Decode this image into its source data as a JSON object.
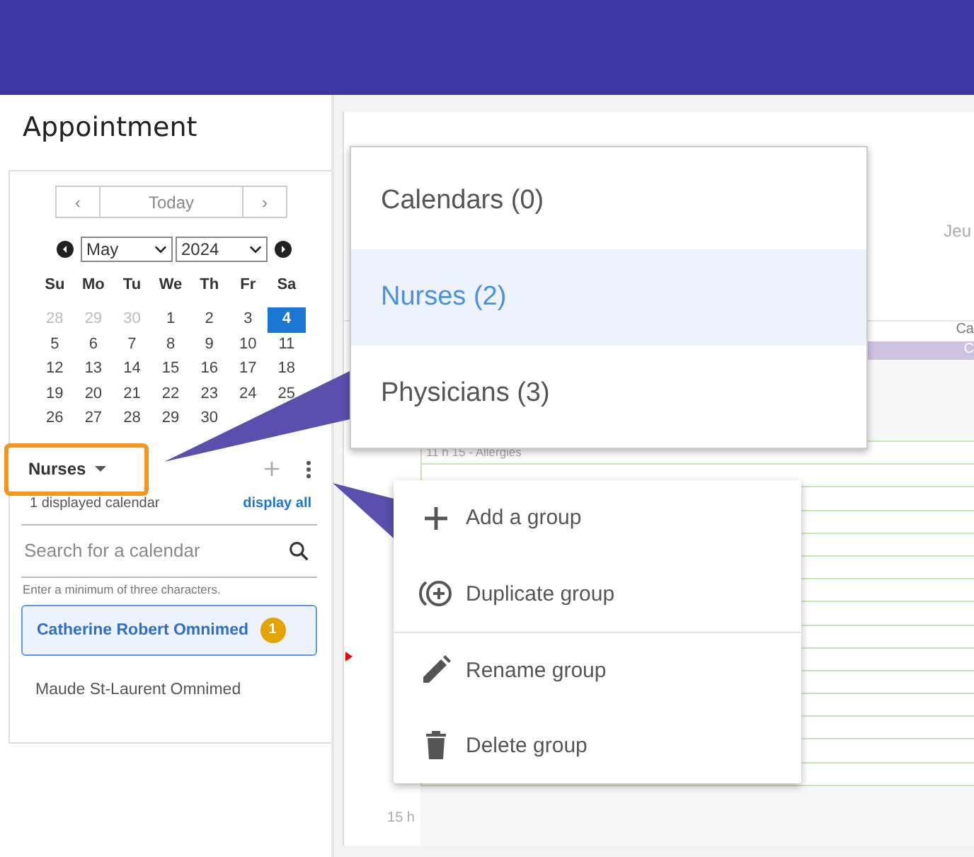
{
  "page_title": "Appointment",
  "mini_calendar": {
    "prev": "‹",
    "today": "Today",
    "next": "›",
    "month": "May",
    "year": "2024",
    "weekdays": [
      "Su",
      "Mo",
      "Tu",
      "We",
      "Th",
      "Fr",
      "Sa"
    ],
    "weeks": [
      [
        {
          "day": "28",
          "muted": true,
          "selected": false
        },
        {
          "day": "29",
          "muted": true,
          "selected": false
        },
        {
          "day": "30",
          "muted": true,
          "selected": false
        },
        {
          "day": "1",
          "muted": false,
          "selected": false
        },
        {
          "day": "2",
          "muted": false,
          "selected": false
        },
        {
          "day": "3",
          "muted": false,
          "selected": false
        },
        {
          "day": "4",
          "muted": false,
          "selected": true
        }
      ],
      [
        {
          "day": "5",
          "muted": false,
          "selected": false
        },
        {
          "day": "6",
          "muted": false,
          "selected": false
        },
        {
          "day": "7",
          "muted": false,
          "selected": false
        },
        {
          "day": "8",
          "muted": false,
          "selected": false
        },
        {
          "day": "9",
          "muted": false,
          "selected": false
        },
        {
          "day": "10",
          "muted": false,
          "selected": false
        },
        {
          "day": "11",
          "muted": false,
          "selected": false
        }
      ],
      [
        {
          "day": "12",
          "muted": false,
          "selected": false
        },
        {
          "day": "13",
          "muted": false,
          "selected": false
        },
        {
          "day": "14",
          "muted": false,
          "selected": false
        },
        {
          "day": "15",
          "muted": false,
          "selected": false
        },
        {
          "day": "16",
          "muted": false,
          "selected": false
        },
        {
          "day": "17",
          "muted": false,
          "selected": false
        },
        {
          "day": "18",
          "muted": false,
          "selected": false
        }
      ],
      [
        {
          "day": "19",
          "muted": false,
          "selected": false
        },
        {
          "day": "20",
          "muted": false,
          "selected": false
        },
        {
          "day": "21",
          "muted": false,
          "selected": false
        },
        {
          "day": "22",
          "muted": false,
          "selected": false
        },
        {
          "day": "23",
          "muted": false,
          "selected": false
        },
        {
          "day": "24",
          "muted": false,
          "selected": false
        },
        {
          "day": "25",
          "muted": false,
          "selected": false
        }
      ],
      [
        {
          "day": "26",
          "muted": false,
          "selected": false
        },
        {
          "day": "27",
          "muted": false,
          "selected": false
        },
        {
          "day": "28",
          "muted": false,
          "selected": false
        },
        {
          "day": "29",
          "muted": false,
          "selected": false
        },
        {
          "day": "30",
          "muted": false,
          "selected": false
        }
      ]
    ]
  },
  "group_selector": {
    "label": "Nurses",
    "highlighted": true
  },
  "displayed_count": "1 displayed calendar",
  "display_all": "display all",
  "search": {
    "placeholder": "Search for a calendar",
    "hint": "Enter a minimum of three characters."
  },
  "calendars": [
    {
      "name": "Catherine Robert Omnimed",
      "selected": true,
      "badge": "1"
    },
    {
      "name": "Maude St-Laurent Omnimed",
      "selected": false
    }
  ],
  "schedule": {
    "day_header": "Jeu",
    "column_header": "Ca",
    "column_band": "C",
    "event": "11 h 15 - Allergies",
    "hour_label": "15 h"
  },
  "group_menu": [
    {
      "label": "Calendars (0)",
      "selected": false
    },
    {
      "label": "Nurses (2)",
      "selected": true
    },
    {
      "label": "Physicians (3)",
      "selected": false
    }
  ],
  "actions_menu": [
    {
      "kind": "add",
      "label": "Add a group",
      "divided": false
    },
    {
      "kind": "duplicate",
      "label": "Duplicate group",
      "divided": false
    },
    {
      "kind": "rename",
      "label": "Rename group",
      "divided": true
    },
    {
      "kind": "delete",
      "label": "Delete group",
      "divided": false
    }
  ]
}
